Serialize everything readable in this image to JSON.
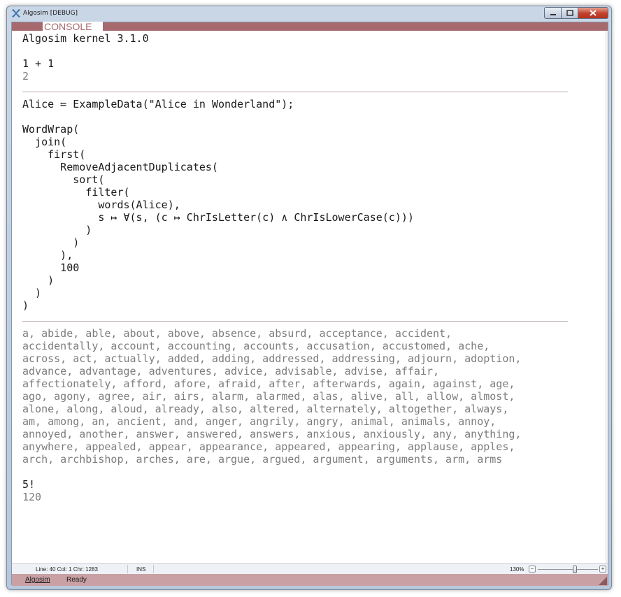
{
  "window": {
    "title": "Algosim [DEBUG]",
    "icons": {
      "app": "algosim-x-icon",
      "minimize": "minimize-icon",
      "maximize": "maximize-icon",
      "close": "close-icon"
    }
  },
  "console": {
    "header": "CONSOLE",
    "blocks": [
      {
        "lines": [
          {
            "text": "Algosim kernel 3.1.0",
            "kind": "output-dark"
          },
          {
            "text": "",
            "kind": "blank"
          },
          {
            "text": "1 + 1",
            "kind": "input"
          },
          {
            "text": "2",
            "kind": "output"
          }
        ]
      },
      {
        "separator": true
      },
      {
        "lines": [
          {
            "text": "Alice ≔ ExampleData(\"Alice in Wonderland\");",
            "kind": "input"
          },
          {
            "text": "",
            "kind": "blank"
          },
          {
            "text": "WordWrap(",
            "kind": "input"
          },
          {
            "text": "  join(",
            "kind": "input"
          },
          {
            "text": "    first(",
            "kind": "input"
          },
          {
            "text": "      RemoveAdjacentDuplicates(",
            "kind": "input"
          },
          {
            "text": "        sort(",
            "kind": "input"
          },
          {
            "text": "          filter(",
            "kind": "input"
          },
          {
            "text": "            words(Alice),",
            "kind": "input"
          },
          {
            "text": "            s ↦ ∀(s, (c ↦ ChrIsLetter(c) ∧ ChrIsLowerCase(c)))",
            "kind": "input"
          },
          {
            "text": "          )",
            "kind": "input"
          },
          {
            "text": "        )",
            "kind": "input"
          },
          {
            "text": "      ),",
            "kind": "input"
          },
          {
            "text": "      100",
            "kind": "input"
          },
          {
            "text": "    )",
            "kind": "input"
          },
          {
            "text": "  )",
            "kind": "input"
          },
          {
            "text": ")",
            "kind": "input"
          }
        ]
      },
      {
        "separator": true
      },
      {
        "lines": [
          {
            "text": "a, abide, able, about, above, absence, absurd, acceptance, accident,",
            "kind": "output"
          },
          {
            "text": "accidentally, account, accounting, accounts, accusation, accustomed, ache,",
            "kind": "output"
          },
          {
            "text": "across, act, actually, added, adding, addressed, addressing, adjourn, adoption,",
            "kind": "output"
          },
          {
            "text": "advance, advantage, adventures, advice, advisable, advise, affair,",
            "kind": "output"
          },
          {
            "text": "affectionately, afford, afore, afraid, after, afterwards, again, against, age,",
            "kind": "output"
          },
          {
            "text": "ago, agony, agree, air, airs, alarm, alarmed, alas, alive, all, allow, almost,",
            "kind": "output"
          },
          {
            "text": "alone, along, aloud, already, also, altered, alternately, altogether, always,",
            "kind": "output"
          },
          {
            "text": "am, among, an, ancient, and, anger, angrily, angry, animal, animals, annoy,",
            "kind": "output"
          },
          {
            "text": "annoyed, another, answer, answered, answers, anxious, anxiously, any, anything,",
            "kind": "output"
          },
          {
            "text": "anywhere, appealed, appear, appearance, appeared, appearing, applause, apples,",
            "kind": "output"
          },
          {
            "text": "arch, archbishop, arches, are, argue, argued, argument, arguments, arm, arms",
            "kind": "output"
          },
          {
            "text": "",
            "kind": "blank"
          },
          {
            "text": "5!",
            "kind": "input"
          },
          {
            "text": "120",
            "kind": "output"
          }
        ]
      }
    ]
  },
  "statusbar": {
    "position": "Line: 40  Col: 1  Chr: 1283",
    "mode": "INS",
    "zoom": "130%",
    "zoom_minus": "−",
    "zoom_plus": "+",
    "zoom_level": 0.62
  },
  "appbar": {
    "menu": "Algosim",
    "status": "Ready"
  },
  "colors": {
    "accent": "#a66a6e",
    "appbar": "#c9a0a3",
    "input_text": "#1a1a1a",
    "output_text": "#7d7d7d",
    "separator": "#b9a7a8"
  }
}
